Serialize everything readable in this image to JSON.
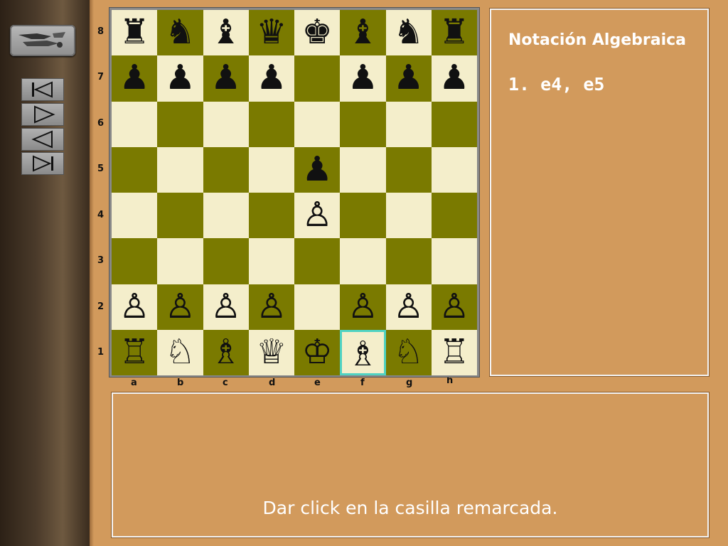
{
  "logo": {
    "icon": "hand-drawn-logo-icon"
  },
  "nav": {
    "buttons": [
      {
        "name": "first-move-button",
        "icon": "skip-to-start-icon"
      },
      {
        "name": "next-move-button",
        "icon": "play-forward-icon"
      },
      {
        "name": "previous-move-button",
        "icon": "play-back-icon"
      },
      {
        "name": "last-move-button",
        "icon": "skip-to-end-icon"
      }
    ]
  },
  "board": {
    "ranks": [
      "8",
      "7",
      "6",
      "5",
      "4",
      "3",
      "2",
      "1"
    ],
    "files": [
      "a",
      "b",
      "c",
      "d",
      "e",
      "f",
      "g",
      "h"
    ],
    "light_color": "#f4eecb",
    "dark_color": "#7a7a00",
    "highlight_color": "#4fd2c2",
    "highlighted_square": "f1",
    "pieces": {
      "a8": "♜",
      "b8": "♞",
      "c8": "♝",
      "d8": "♛",
      "e8": "♚",
      "f8": "♝",
      "g8": "♞",
      "h8": "♜",
      "a7": "♟",
      "b7": "♟",
      "c7": "♟",
      "d7": "♟",
      "f7": "♟",
      "g7": "♟",
      "h7": "♟",
      "e5": "♟",
      "e4": "♙",
      "a2": "♙",
      "b2": "♙",
      "c2": "♙",
      "d2": "♙",
      "f2": "♙",
      "g2": "♙",
      "h2": "♙",
      "a1": "♖",
      "b1": "♘",
      "c1": "♗",
      "d1": "♕",
      "e1": "♔",
      "f1": "♗",
      "g1": "♘",
      "h1": "♖"
    }
  },
  "notation": {
    "title": "Notación Algebraica",
    "moves": "1. e4, e5"
  },
  "message": {
    "text": "Dar click en la casilla remarcada."
  }
}
